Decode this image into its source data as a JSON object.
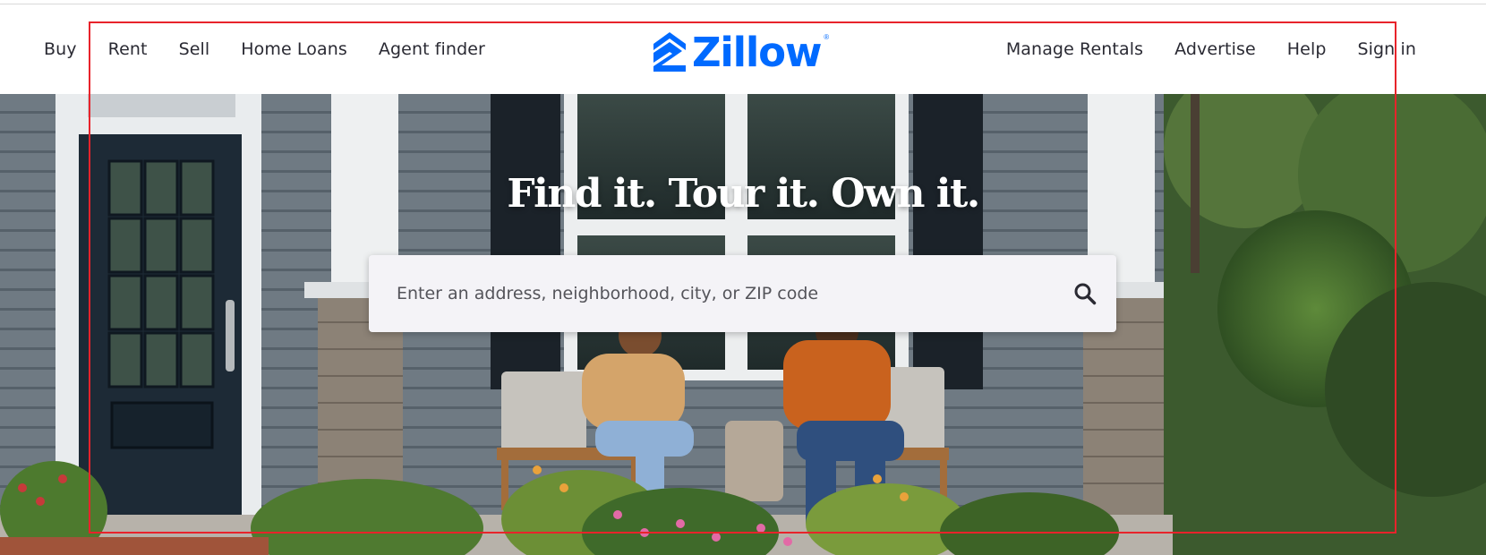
{
  "nav": {
    "left_links": [
      "Buy",
      "Rent",
      "Sell",
      "Home Loans",
      "Agent finder"
    ],
    "right_links": [
      "Manage Rentals",
      "Advertise",
      "Help",
      "Sign in"
    ]
  },
  "logo": {
    "text": "Zillow",
    "registered_mark": "®",
    "icon": "zillow-house-icon",
    "color": "#006aff"
  },
  "hero": {
    "headline": "Find it. Tour it. Own it.",
    "image": "family-on-front-porch-photo"
  },
  "search": {
    "placeholder": "Enter an address, neighborhood, city, or ZIP code",
    "value": "",
    "icon": "search-icon"
  },
  "colors": {
    "brand_blue": "#006aff",
    "nav_text": "#2a2a33",
    "highlight_frame": "#e8232b"
  }
}
